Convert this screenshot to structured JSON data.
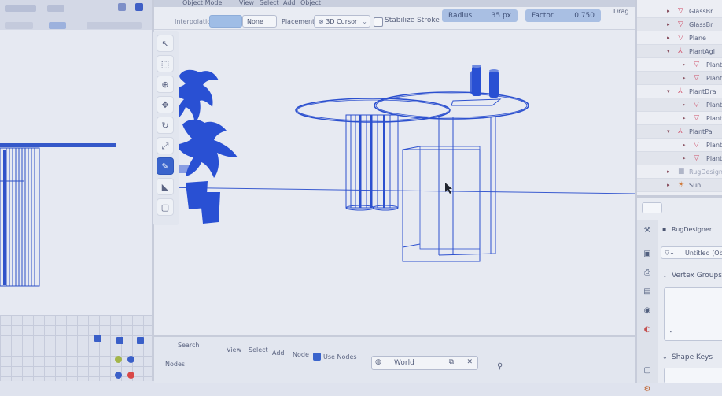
{
  "header": {
    "interpolation_label": "Interpolation",
    "falloff_value": "None",
    "placement_label": "Placement:",
    "placement_value": "3D Cursor",
    "stabilize_label": "Stabilize Stroke",
    "radius_label": "Radius",
    "radius_value": "35 px",
    "factor_label": "Factor",
    "factor_value": "0.750",
    "drag_label": "Drag",
    "mode_value": "Object Mode",
    "menu_view": "View",
    "menu_select": "Select",
    "menu_add": "Add",
    "menu_object": "Object"
  },
  "outliner": {
    "items": [
      {
        "label": "GlassBr"
      },
      {
        "label": "GlassBr"
      },
      {
        "label": "Plane"
      },
      {
        "label": "PlantAgl"
      },
      {
        "label": "Plant"
      },
      {
        "label": "Plant"
      },
      {
        "label": "PlantDra"
      },
      {
        "label": "Plant"
      },
      {
        "label": "Plant"
      },
      {
        "label": "PlantPal"
      },
      {
        "label": "Plant"
      },
      {
        "label": "Plant"
      },
      {
        "label": "RugDesigner"
      },
      {
        "label": "Sun"
      }
    ]
  },
  "properties": {
    "object_name": "RugDesigner",
    "material_slot": "Untitled (Ob",
    "vertex_groups_label": "Vertex Groups",
    "shape_keys_label": "Shape Keys"
  },
  "bottom": {
    "menu_view": "View",
    "menu_select": "Select",
    "menu_add": "Add",
    "menu_node": "Node",
    "use_nodes_label": "Use Nodes",
    "world_value": "World",
    "search_label": "Search",
    "slot_label": "Nodes"
  },
  "colors": {
    "wire": "#2a4fd0",
    "accent": "#3a64cc",
    "selected_slider": "#a9bfe3"
  }
}
